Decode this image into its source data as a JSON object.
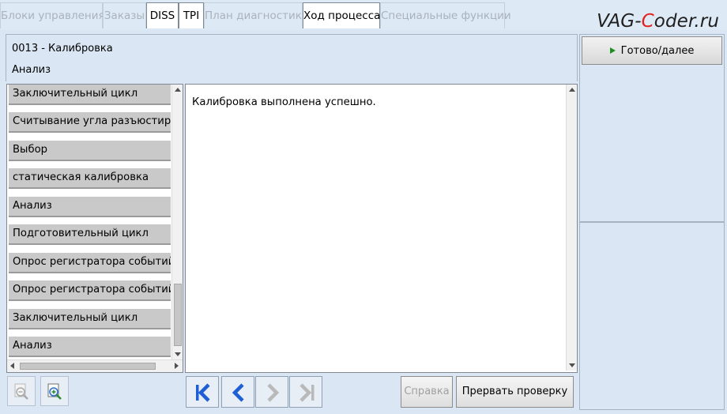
{
  "tabs": [
    {
      "label": "Блоки управления",
      "active": false
    },
    {
      "label": "Заказы",
      "active": false
    },
    {
      "label": "DISS",
      "active": true
    },
    {
      "label": "TPI",
      "active": true
    },
    {
      "label": "План диагностики",
      "active": false
    },
    {
      "label": "Ход процесса",
      "active": true
    },
    {
      "label": "Специальные функции",
      "active": false
    }
  ],
  "watermark": {
    "part1": "VAG-",
    "part2": "C",
    "part3": "oder.ru"
  },
  "header": {
    "code": "0013 - Калибровка",
    "subtitle": "Анализ"
  },
  "next_button": {
    "label": "Готово/далее"
  },
  "steps": [
    "Заключительный цикл",
    "Считывание угла разъюстировки",
    "Выбор",
    "статическая калибровка",
    "Анализ",
    "Подготовительный цикл",
    "Опрос регистратора событий",
    "Опрос регистратора событий",
    "Заключительный цикл",
    "Анализ"
  ],
  "message": {
    "text": "Калибровка выполнена успешно."
  },
  "bottom": {
    "help_label": "Справка",
    "abort_label": "Прервать проверку"
  },
  "colors": {
    "accent_blue": "#1f5fd6",
    "play_green": "#1b8f24",
    "watermark_red": "#e3201c"
  }
}
